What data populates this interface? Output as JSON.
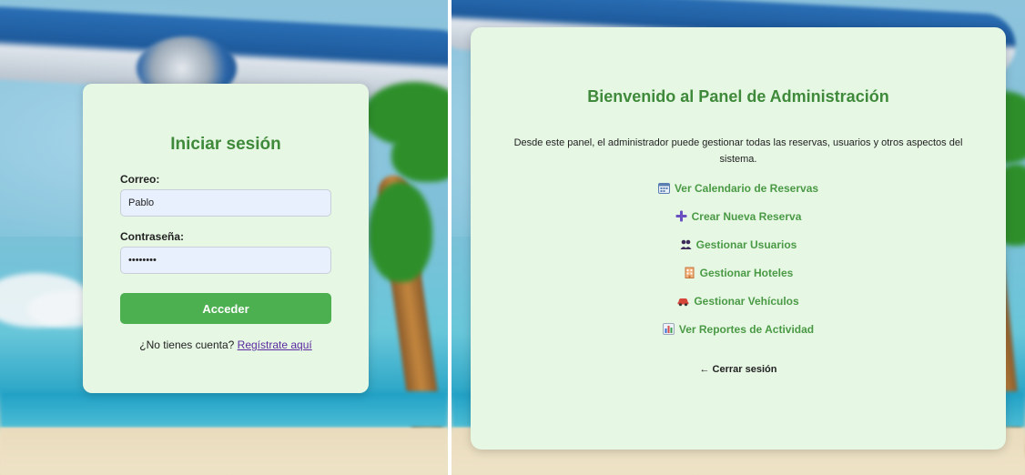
{
  "login": {
    "title": "Iniciar sesión",
    "email_label": "Correo:",
    "email_value": "Pablo",
    "password_label": "Contraseña:",
    "password_value": "pablo123",
    "submit_label": "Acceder",
    "signup_prompt": "¿No tienes cuenta?",
    "signup_link": "Regístrate aquí"
  },
  "admin": {
    "title": "Bienvenido al Panel de Administración",
    "description": "Desde este panel, el administrador puede gestionar todas las reservas, usuarios y otros aspectos del sistema.",
    "menu": [
      {
        "label": "Ver Calendario de Reservas",
        "icon": "calendar-icon"
      },
      {
        "label": "Crear Nueva Reserva",
        "icon": "plus-icon"
      },
      {
        "label": "Gestionar Usuarios",
        "icon": "users-icon"
      },
      {
        "label": "Gestionar Hoteles",
        "icon": "hotel-icon"
      },
      {
        "label": "Gestionar Vehículos",
        "icon": "car-icon"
      },
      {
        "label": "Ver Reportes de Actividad",
        "icon": "bar-chart-icon"
      }
    ],
    "logout_label": "← Cerrar sesión"
  },
  "colors": {
    "card_bg": "#e6f7e4",
    "accent_green": "#4caf50",
    "title_green": "#3f8a3a",
    "link_purple": "#5a2aa0",
    "input_bg": "#e8f0fd"
  }
}
